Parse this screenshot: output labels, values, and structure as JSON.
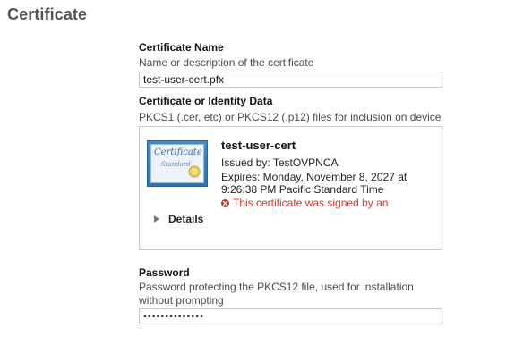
{
  "page": {
    "title": "Certificate"
  },
  "certificate_name": {
    "label": "Certificate Name",
    "description": "Name or description of the certificate",
    "value": "test-user-cert.pfx"
  },
  "identity_data": {
    "label": "Certificate or Identity Data",
    "description": "PKCS1 (.cer, etc) or PKCS12 (.p12) files for inclusion on device",
    "certificate": {
      "thumbnail_title": "Certificate",
      "thumbnail_subtitle": "Standard",
      "name": "test-user-cert",
      "issued_by": "Issued by: TestOVPNCA",
      "expires_line1": "Expires: Monday, November 8, 2027 at",
      "expires_line2": "9:26:38 PM Pacific Standard Time",
      "warning": "This certificate was signed by an",
      "warning_icon": "error-circle-x-icon",
      "warning_color": "#d0352b",
      "details_label": "Details",
      "details_icon": "disclosure-triangle-icon"
    }
  },
  "password": {
    "label": "Password",
    "description_line1": "Password protecting the PKCS12 file, used for installation",
    "description_line2": "without prompting",
    "masked_value": "••••••••••••••"
  }
}
